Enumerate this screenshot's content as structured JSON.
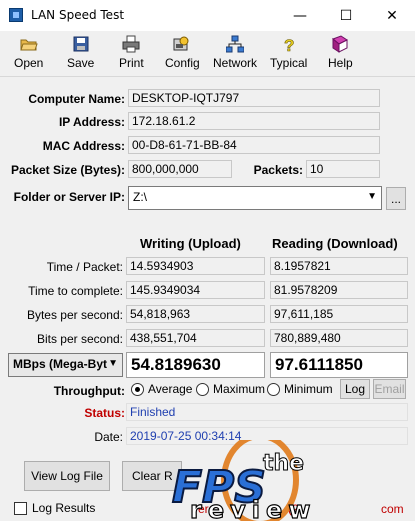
{
  "window": {
    "title": "LAN Speed Test",
    "min_glyph": "—",
    "max_glyph": "☐",
    "close_glyph": "✕"
  },
  "toolbar": [
    {
      "label": "Open",
      "icon": "folder-open-icon"
    },
    {
      "label": "Save",
      "icon": "save-icon"
    },
    {
      "label": "Print",
      "icon": "printer-icon"
    },
    {
      "label": "Config",
      "icon": "config-icon"
    },
    {
      "label": "Network",
      "icon": "network-icon"
    },
    {
      "label": "Typical",
      "icon": "question-icon"
    },
    {
      "label": "Help",
      "icon": "help-book-icon"
    }
  ],
  "info": {
    "computer_name_label": "Computer Name:",
    "computer_name": "DESKTOP-IQTJ797",
    "ip_label": "IP Address:",
    "ip": "172.18.61.2",
    "mac_label": "MAC Address:",
    "mac": "00-D8-61-71-BB-84",
    "packet_size_label": "Packet Size (Bytes):",
    "packet_size": "800,000,000",
    "packets_label": "Packets:",
    "packets": "10",
    "folder_label": "Folder or Server IP:",
    "folder": "Z:\\",
    "browse_label": "..."
  },
  "results": {
    "writing_head": "Writing (Upload)",
    "reading_head": "Reading (Download)",
    "rows": [
      {
        "label": "Time / Packet:",
        "write": "14.5934903",
        "read": "8.1957821"
      },
      {
        "label": "Time to complete:",
        "write": "145.9349034",
        "read": "81.9578209"
      },
      {
        "label": "Bytes per second:",
        "write": "54,818,963",
        "read": "97,611,185"
      },
      {
        "label": "Bits per second:",
        "write": "438,551,704",
        "read": "780,889,480"
      }
    ],
    "unit_select": "MBps (Mega-Byt",
    "big_write": "54.8189630",
    "big_read": "97.6111850"
  },
  "throughput": {
    "label": "Throughput:",
    "options": [
      "Average",
      "Maximum",
      "Minimum"
    ],
    "selected": "Average",
    "log_label": "Log",
    "email_label": "Email"
  },
  "status": {
    "label": "Status:",
    "value": "Finished",
    "label_color": "#c00000",
    "value_color": "#1f3fb0"
  },
  "date": {
    "label": "Date:",
    "value": "2019-07-25 00:34:14"
  },
  "footer": {
    "view_log": "View Log File",
    "clear": "Clear R",
    "log_results": "Log Results",
    "fragment_1": "ers",
    "fragment_2": "(2",
    "fragment_3": "com"
  },
  "watermark": {
    "line1": "the",
    "line2": "FPS",
    "line3": "review"
  },
  "colors": {
    "accent_orange": "#e07a1a",
    "watermark_blue": "#2a6fd6"
  }
}
